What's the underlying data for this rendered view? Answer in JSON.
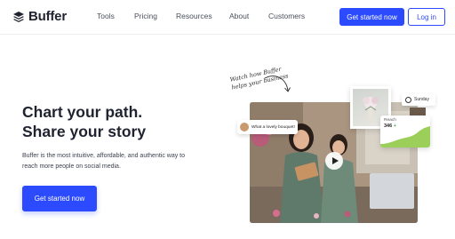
{
  "brand": {
    "name": "Buffer"
  },
  "nav": {
    "links": [
      "Tools",
      "Pricing",
      "Resources",
      "About",
      "Customers"
    ],
    "cta_label": "Get started now",
    "login_label": "Log in"
  },
  "hero": {
    "title_line1": "Chart your path.",
    "title_line2": "Share your story",
    "subtitle": "Buffer is the most intuitive, affordable, and authentic way to reach more people on social media.",
    "cta_label": "Get started now"
  },
  "media": {
    "handwriting_line1": "Watch how Buffer",
    "handwriting_line2": "helps your business",
    "comment_text": "What a lovely bouquet!",
    "schedule_day": "Sunday",
    "reach_label": "Reach",
    "reach_value": "346",
    "reach_change": "+"
  },
  "colors": {
    "brand_blue": "#2c4bff",
    "reach_green": "#9bcf5a"
  }
}
